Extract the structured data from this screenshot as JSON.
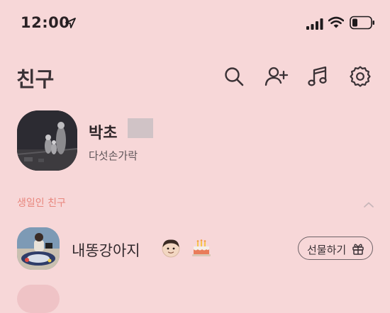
{
  "status_bar": {
    "time": "12:00"
  },
  "header": {
    "title": "친구",
    "icons": [
      "search-icon",
      "add-friend-icon",
      "music-icon",
      "settings-icon"
    ]
  },
  "profile": {
    "name": "박초",
    "status_message": "다섯손가락"
  },
  "birthday_section": {
    "title": "생일인 친구",
    "friends": [
      {
        "name": "내똥강아지",
        "gift_button_label": "선물하기"
      }
    ]
  },
  "colors": {
    "background": "#f7d7d8",
    "accent_section_title": "#e8877e",
    "text_primary": "#2a2124"
  }
}
